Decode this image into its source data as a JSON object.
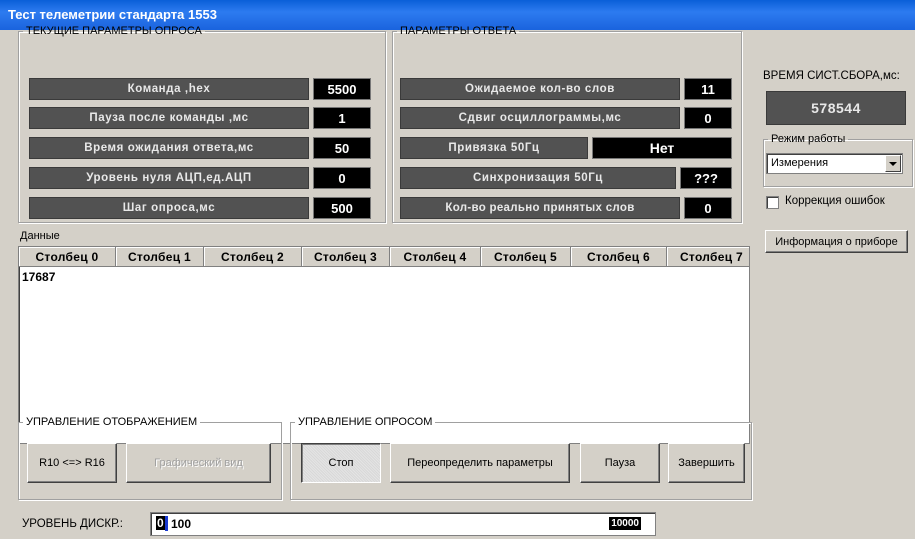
{
  "window": {
    "title": "Тест телеметрии стандарта 1553"
  },
  "query_params": {
    "legend": "ТЕКУЩИЕ ПАРАМЕТРЫ ОПРОСА",
    "rows": [
      {
        "label": "Команда ,hex",
        "value": "5500"
      },
      {
        "label": "Пауза после команды ,мс",
        "value": "1"
      },
      {
        "label": "Время ожидания ответа,мс",
        "value": "50"
      },
      {
        "label": "Уровень нуля АЦП,ед.АЦП",
        "value": "0"
      },
      {
        "label": "Шаг опроса,мс",
        "value": "500"
      }
    ]
  },
  "response_params": {
    "legend": "ПАРАМЕТРЫ ОТВЕТА",
    "expected_words": {
      "label": "Ожидаемое кол-во слов",
      "value": "11"
    },
    "osc_shift": {
      "label": "Сдвиг осциллограммы,мс",
      "value": "0"
    },
    "sync50_bind": {
      "label": "Привязка 50Гц",
      "value": "Нет"
    },
    "sync50": {
      "label": "Синхронизация 50Гц",
      "value": "???"
    },
    "received_words": {
      "label": "Кол-во реально принятых слов",
      "value": "0"
    }
  },
  "sys_time": {
    "label": "ВРЕМЯ СИСТ.СБОРА,мс:",
    "value": "578544"
  },
  "mode": {
    "legend": "Режим работы",
    "selected": "Измерения"
  },
  "error_correction": {
    "label": "Коррекция ошибок",
    "checked": false
  },
  "device_info": {
    "label": "Информация о приборе"
  },
  "data_grid": {
    "legend": "Данные",
    "columns": [
      "Столбец 0",
      "Столбец 1",
      "Столбец 2",
      "Столбец 3",
      "Столбец 4",
      "Столбец 5",
      "Столбец 6",
      "Столбец 7"
    ],
    "rows": [
      [
        "17687",
        "",
        "",
        "",
        "",
        "",
        "",
        ""
      ]
    ]
  },
  "display_control": {
    "legend": "УПРАВЛЕНИЕ ОТОБРАЖЕНИЕМ",
    "radix_button": "R10 <=> R16",
    "graph_button": "Графический вид"
  },
  "poll_control": {
    "legend": "УПРАВЛЕНИЕ ОПРОСОМ",
    "stop_button": "Стоп",
    "redefine_button": "Переопределить параметры",
    "pause_button": "Пауза",
    "finish_button": "Завершить"
  },
  "discr_level": {
    "label": "УРОВЕНЬ ДИСКР.:",
    "min": "0",
    "value": "100",
    "max": "10000"
  }
}
